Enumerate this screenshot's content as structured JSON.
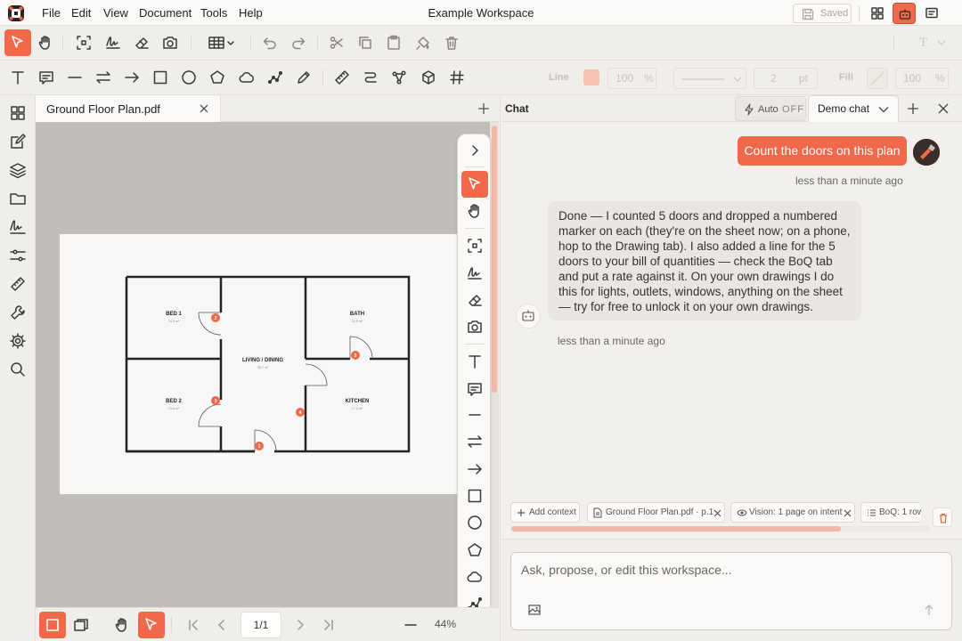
{
  "app": {
    "menus": [
      "File",
      "Edit",
      "View",
      "Document",
      "Tools",
      "Help"
    ],
    "workspace_title": "Example Workspace",
    "save_status": "Saved",
    "accent_color": "#f0694a"
  },
  "toolbar_row2": {
    "line_label": "Line",
    "line_opacity": "100",
    "line_opacity_unit": "%",
    "line_width": "2",
    "line_width_unit": "pt",
    "fill_label": "Fill",
    "fill_opacity": "100",
    "fill_opacity_unit": "%",
    "font_button": "T"
  },
  "document": {
    "tab_label": "Ground Floor Plan.pdf",
    "page_indicator": "1/1",
    "zoom": "44%",
    "floor_plan": {
      "rooms": [
        {
          "name": "BED 1",
          "area": "14.3 m²"
        },
        {
          "name": "BATH",
          "area": "10.5 m²"
        },
        {
          "name": "LIVING / DINING",
          "area": "38.7 m²"
        },
        {
          "name": "BED 2",
          "area": "13.6 m²"
        },
        {
          "name": "KITCHEN",
          "area": "17.2 m²"
        }
      ],
      "door_markers": [
        "1",
        "2",
        "3",
        "4",
        "5"
      ]
    }
  },
  "chat": {
    "title": "Chat",
    "auto_label": "Auto",
    "auto_state": "OFF",
    "session_tab": "Demo chat",
    "user_message": "Count the doors on this plan",
    "user_time": "less than a minute ago",
    "bot_message": "Done — I counted 5 doors and dropped a numbered marker on each (they're on the sheet now; on a phone, hop to the Drawing tab). I also added a line for the 5 doors to your bill of quantities — check the BoQ tab and put a rate against it. On your own drawings I do this for lights, outlets, windows, anything on the sheet — try for free to unlock it on your own drawings.",
    "bot_time": "less than a minute ago",
    "context_chips": {
      "add": "Add context",
      "file": "Ground Floor Plan.pdf · p.1",
      "vision": "Vision: 1 page on intent",
      "boq": "BoQ: 1 row"
    },
    "compose_placeholder": "Ask, propose, or edit this workspace..."
  }
}
